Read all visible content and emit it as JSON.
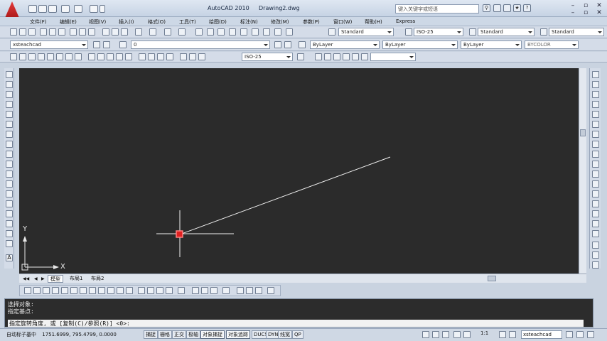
{
  "window": {
    "app_title": "AutoCAD 2010",
    "doc_title": "Drawing2.dwg",
    "search_placeholder": "键入关键字或短语"
  },
  "menu": [
    "文件(F)",
    "编辑(E)",
    "视图(V)",
    "插入(I)",
    "格式(O)",
    "工具(T)",
    "绘图(D)",
    "标注(N)",
    "修改(M)",
    "参数(P)",
    "窗口(W)",
    "帮助(H)",
    "Express"
  ],
  "styles": {
    "text_style": "Standard",
    "dim_style": "ISO-25",
    "table_style": "Standard",
    "multileader_style": "Standard"
  },
  "layers": {
    "workspace_combo": "xsteachcad",
    "current_layer": "0",
    "annot_scale": "ISO-25"
  },
  "properties": {
    "color": "ByLayer",
    "linetype": "ByLayer",
    "lineweight": "ByLayer",
    "plotstyle": "BYCOLOR"
  },
  "canvas": {
    "background": "#2b2b2b",
    "line_color": "#f2f2f2",
    "crosshair_color": "#f2f2f2",
    "grip_color": "#e02020",
    "ucs_y": "Y",
    "ucs_x": "X"
  },
  "tabs": [
    "模型",
    "布局1",
    "布局2"
  ],
  "command": {
    "history": [
      "选择对象:",
      "指定基点:"
    ],
    "prompt": "指定旋转角度, 或 [复制(C)/参照(R)] <0>:"
  },
  "status": {
    "coords_label": "自动标子基中",
    "coords": "1751.6999, 795.4799, 0.0000",
    "toggles": [
      {
        "label": "捕捉",
        "on": false
      },
      {
        "label": "栅格",
        "on": false
      },
      {
        "label": "正交",
        "on": false
      },
      {
        "label": "极轴",
        "on": false
      },
      {
        "label": "对象捕捉",
        "on": true
      },
      {
        "label": "对象追踪",
        "on": true
      },
      {
        "label": "DUCS",
        "on": false
      },
      {
        "label": "DYN",
        "on": false
      },
      {
        "label": "线宽",
        "on": false
      },
      {
        "label": "QP",
        "on": false
      }
    ],
    "scale": "1:1",
    "workspace": "xsteachcad"
  }
}
